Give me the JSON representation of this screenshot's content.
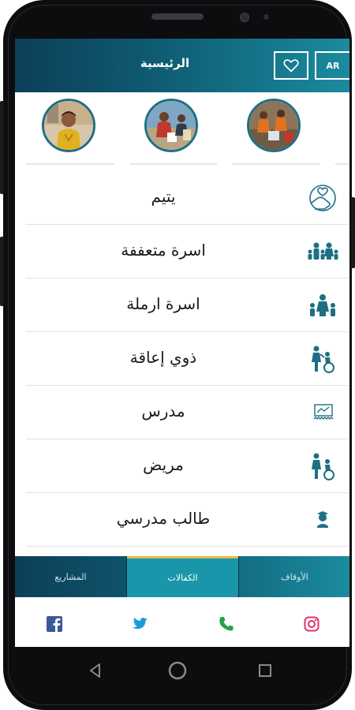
{
  "header": {
    "title": "الرئيسية",
    "lang_label": "AR",
    "heart_icon": "heart-outline-icon"
  },
  "stories": [
    {
      "name": "story-child"
    },
    {
      "name": "story-workers"
    },
    {
      "name": "story-aid"
    }
  ],
  "categories": [
    {
      "label": "يتيم",
      "icon": "hand-heart-icon"
    },
    {
      "label": "اسرة متعففة",
      "icon": "family-icon"
    },
    {
      "label": "اسرة ارملة",
      "icon": "widow-family-icon"
    },
    {
      "label": "ذوي إعاقة",
      "icon": "wheelchair-icon"
    },
    {
      "label": "مدرس",
      "icon": "teacher-board-icon"
    },
    {
      "label": "مريض",
      "icon": "patient-wheelchair-icon"
    },
    {
      "label": "طالب مدرسي",
      "icon": "student-icon"
    }
  ],
  "tabs": [
    {
      "label": "المشاريع",
      "active": false
    },
    {
      "label": "الكفالات",
      "active": true
    },
    {
      "label": "الأوقاف",
      "active": false
    }
  ],
  "social": [
    "facebook-icon",
    "twitter-icon",
    "phone-icon",
    "instagram-icon"
  ],
  "colors": {
    "primary": "#0f5d74",
    "accent": "#1a96aa",
    "active_tab_border": "#e6b94d",
    "facebook": "#3b5998",
    "twitter": "#1da1f2",
    "phone": "#25a244",
    "instagram": "#e1306c"
  }
}
